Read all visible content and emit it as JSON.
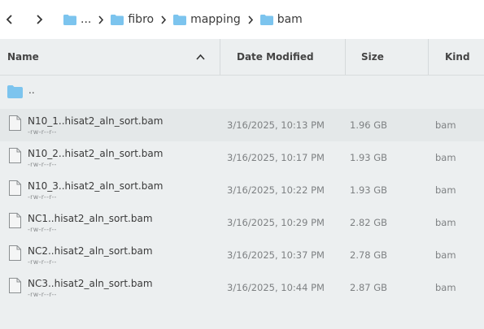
{
  "breadcrumb": {
    "items": [
      {
        "label": "..."
      },
      {
        "label": "fibro"
      },
      {
        "label": "mapping"
      },
      {
        "label": "bam"
      }
    ]
  },
  "columns": {
    "name": "Name",
    "date": "Date Modified",
    "size": "Size",
    "kind": "Kind"
  },
  "parent_label": "..",
  "files": [
    {
      "name": "N10_1..hisat2_aln_sort.bam",
      "perm": "-rw-r--r--",
      "date": "3/16/2025, 10:13 PM",
      "size": "1.96 GB",
      "kind": "bam"
    },
    {
      "name": "N10_2..hisat2_aln_sort.bam",
      "perm": "-rw-r--r--",
      "date": "3/16/2025, 10:17 PM",
      "size": "1.93 GB",
      "kind": "bam"
    },
    {
      "name": "N10_3..hisat2_aln_sort.bam",
      "perm": "-rw-r--r--",
      "date": "3/16/2025, 10:22 PM",
      "size": "1.93 GB",
      "kind": "bam"
    },
    {
      "name": "NC1..hisat2_aln_sort.bam",
      "perm": "-rw-r--r--",
      "date": "3/16/2025, 10:29 PM",
      "size": "2.82 GB",
      "kind": "bam"
    },
    {
      "name": "NC2..hisat2_aln_sort.bam",
      "perm": "-rw-r--r--",
      "date": "3/16/2025, 10:37 PM",
      "size": "2.78 GB",
      "kind": "bam"
    },
    {
      "name": "NC3..hisat2_aln_sort.bam",
      "perm": "-rw-r--r--",
      "date": "3/16/2025, 10:44 PM",
      "size": "2.87 GB",
      "kind": "bam"
    }
  ],
  "colors": {
    "folder": "#7cc4ee",
    "background": "#eceff0",
    "row_alt": "#e4e8e9"
  },
  "icons": {
    "back": "chevron-left-icon",
    "forward": "chevron-right-icon",
    "folder": "folder-icon",
    "file": "file-icon",
    "sort": "chevron-up-icon"
  }
}
